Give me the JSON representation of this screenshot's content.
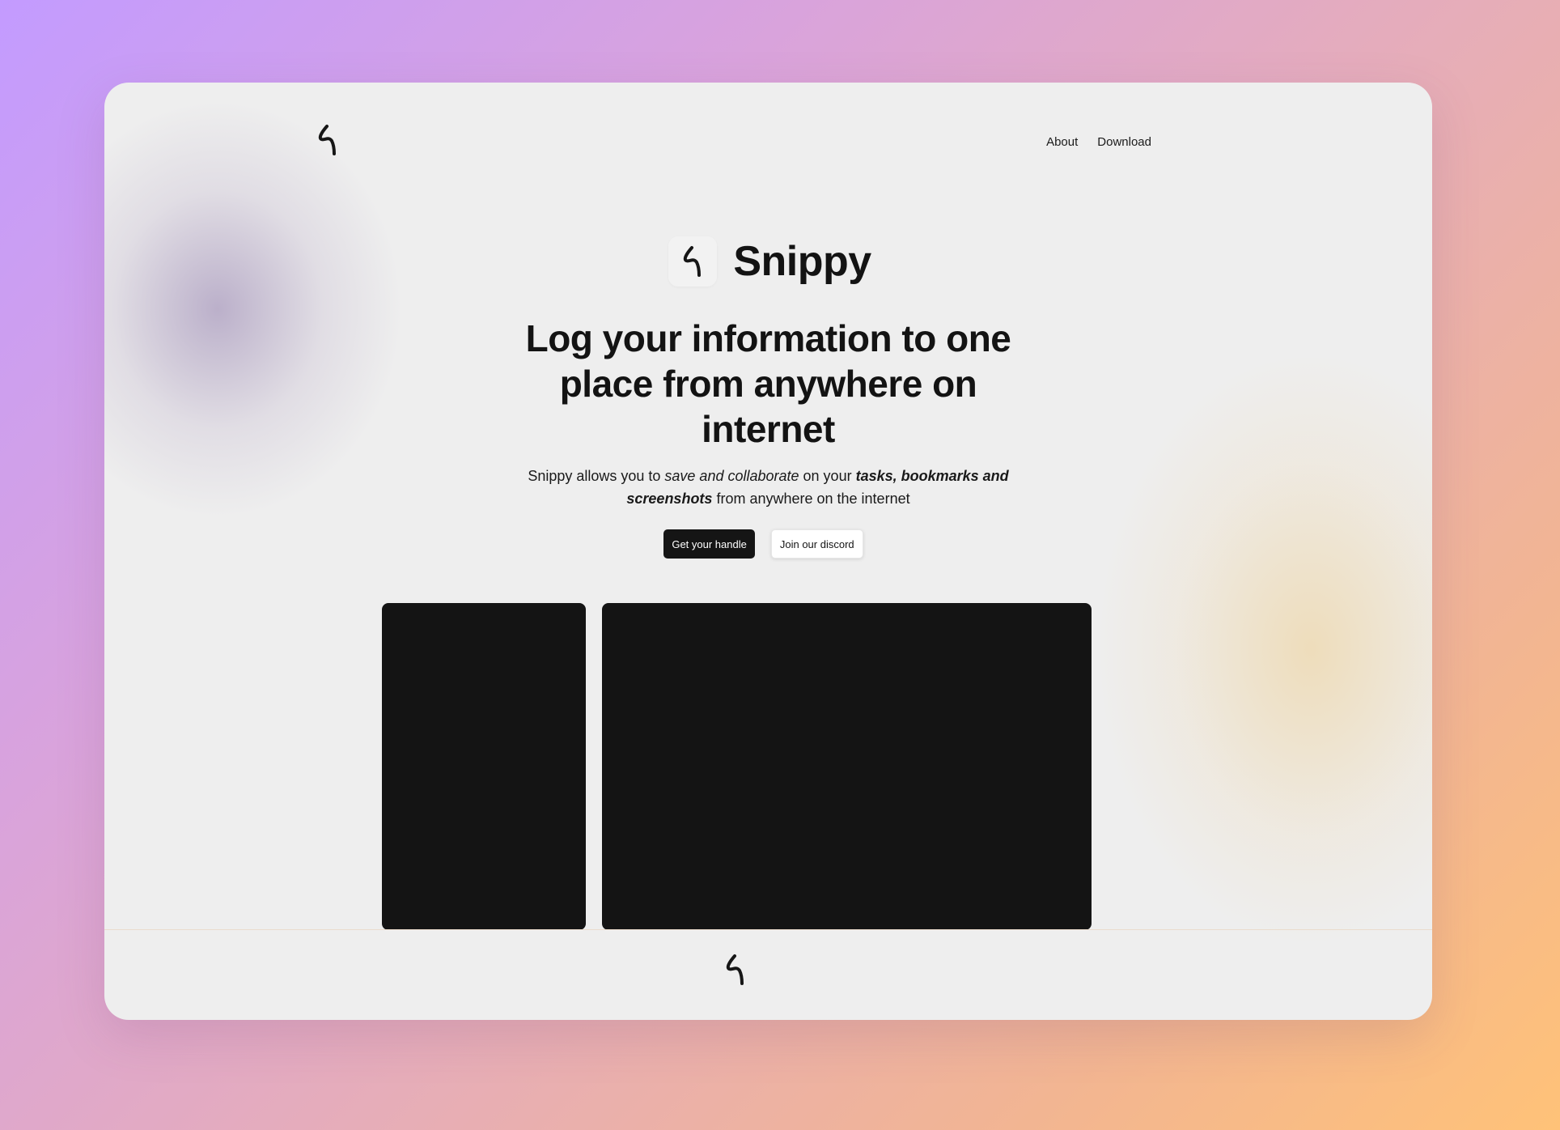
{
  "nav": {
    "logo_icon": "snippy-logo-icon",
    "links": [
      {
        "label": "About"
      },
      {
        "label": "Download"
      }
    ]
  },
  "hero": {
    "brand_icon": "snippy-logo-icon",
    "brand_name": "Snippy",
    "headline": "Log your information to one place from anywhere on internet",
    "subtext": {
      "part1": "Snippy allows you to ",
      "part2_italic": "save and collaborate",
      "part3": " on your ",
      "part4_bold_italic": "tasks, bookmarks and screenshots",
      "part5": " from anywhere on the internet"
    },
    "buttons": {
      "primary": "Get your handle",
      "secondary": "Join our discord"
    }
  },
  "footer": {
    "logo_icon": "snippy-logo-icon"
  },
  "colors": {
    "card_background": "#eeeeee",
    "text_primary": "#131313",
    "panel_dark": "#141414",
    "button_primary_bg": "#151515",
    "button_secondary_bg": "#ffffff"
  }
}
